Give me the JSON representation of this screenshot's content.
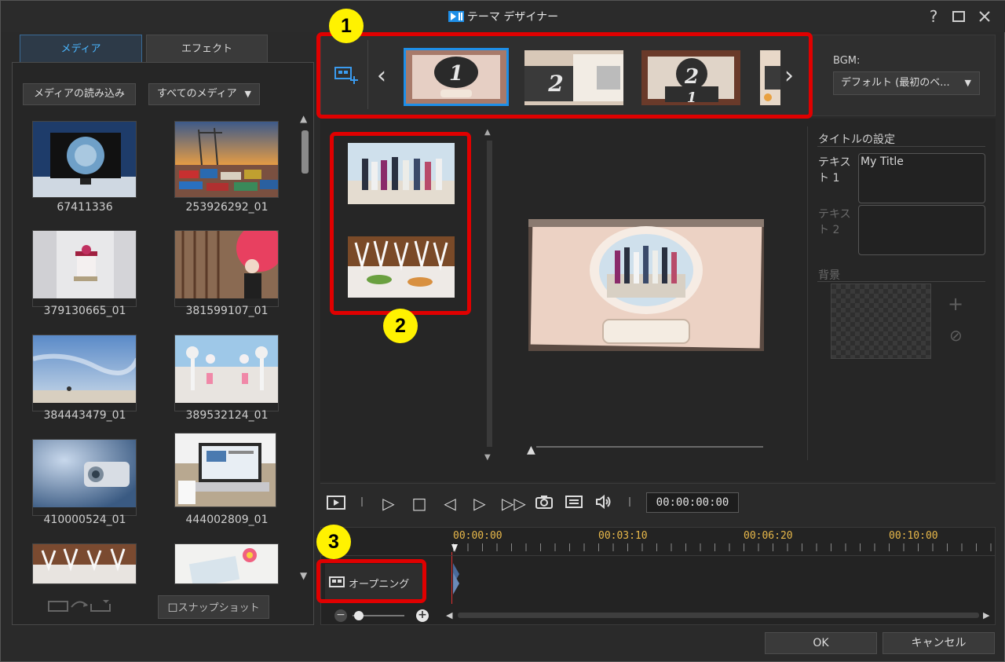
{
  "window": {
    "title": "テーマ デザイナー",
    "help": "?",
    "maximize": "□",
    "close": "✕"
  },
  "tabs": {
    "media": "メディア",
    "effect": "エフェクト"
  },
  "media_panel": {
    "import_button": "メディアの読み込み",
    "filter_select": "すべてのメディア",
    "items": [
      "67411336",
      "253926292_01",
      "379130665_01",
      "381599107_01",
      "384443479_01",
      "389532124_01",
      "410000524_01",
      "444002809_01"
    ],
    "snapshot_button": "スナップショット"
  },
  "theme_strip": {
    "bgm_label": "BGM:",
    "bgm_value": "デフォルト (最初のベ...",
    "slots": [
      "1",
      "2",
      "2",
      "1"
    ]
  },
  "title_settings": {
    "heading": "タイトルの設定",
    "text1_label": "テキスト 1",
    "text1_value": "My Title",
    "text2_label": "テキスト 2",
    "background_label": "背景"
  },
  "playback": {
    "timecode": "00:00:00:00"
  },
  "timeline": {
    "ruler": [
      "00:00:00",
      "00:03:10",
      "00:06:20",
      "00:10:00"
    ],
    "track_label": "オープニング"
  },
  "annotations": [
    "1",
    "2",
    "3"
  ],
  "footer": {
    "ok": "OK",
    "cancel": "キャンセル"
  },
  "colors": {
    "accent": "#1e8fe8",
    "highlight": "#e00000",
    "badge": "#fff200",
    "ruler_text": "#e8b84a"
  }
}
